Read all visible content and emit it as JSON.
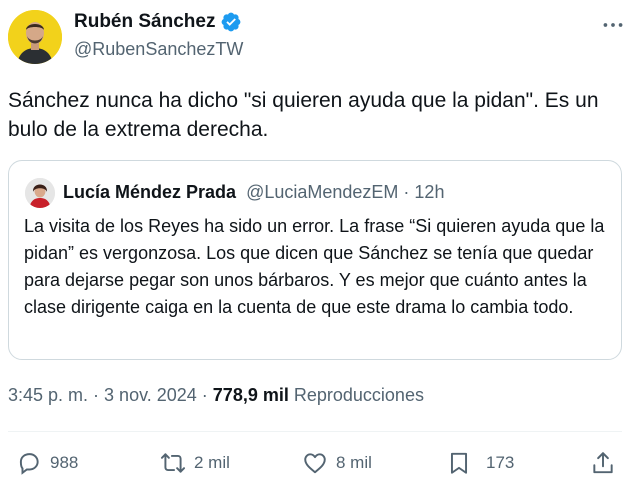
{
  "author": {
    "name": "Rubén Sánchez",
    "handle": "@RubenSanchezTW",
    "verified_color": "#1d9bf0"
  },
  "tweet": {
    "text": "Sánchez nunca ha dicho \"si quieren ayuda que la pidan\". Es un bulo de la extrema derecha."
  },
  "quoted": {
    "name": "Lucía Méndez Prada",
    "handle": "@LuciaMendezEM",
    "separator": " · ",
    "time": "12h",
    "text": "La visita de los Reyes ha sido un error. La frase “Si quieren ayuda que la pidan” es vergonzosa. Los que dicen que Sánchez se tenía que quedar para dejarse pegar son unos bárbaros. Y es mejor que cuánto antes la clase dirigente caiga en la cuenta de que este drama lo cambia todo."
  },
  "meta": {
    "time": "3:45 p. m.",
    "sep1": " · ",
    "date": "3 nov. 2024",
    "sep2": " · ",
    "views": "778,9 mil",
    "views_label": "Reproducciones"
  },
  "actions": {
    "replies": "988",
    "retweets": "2 mil",
    "likes": "8 mil",
    "bookmarks": "173"
  },
  "icons": [
    "more-icon",
    "verified-icon",
    "reply-icon",
    "retweet-icon",
    "like-icon",
    "bookmark-icon",
    "share-icon"
  ]
}
